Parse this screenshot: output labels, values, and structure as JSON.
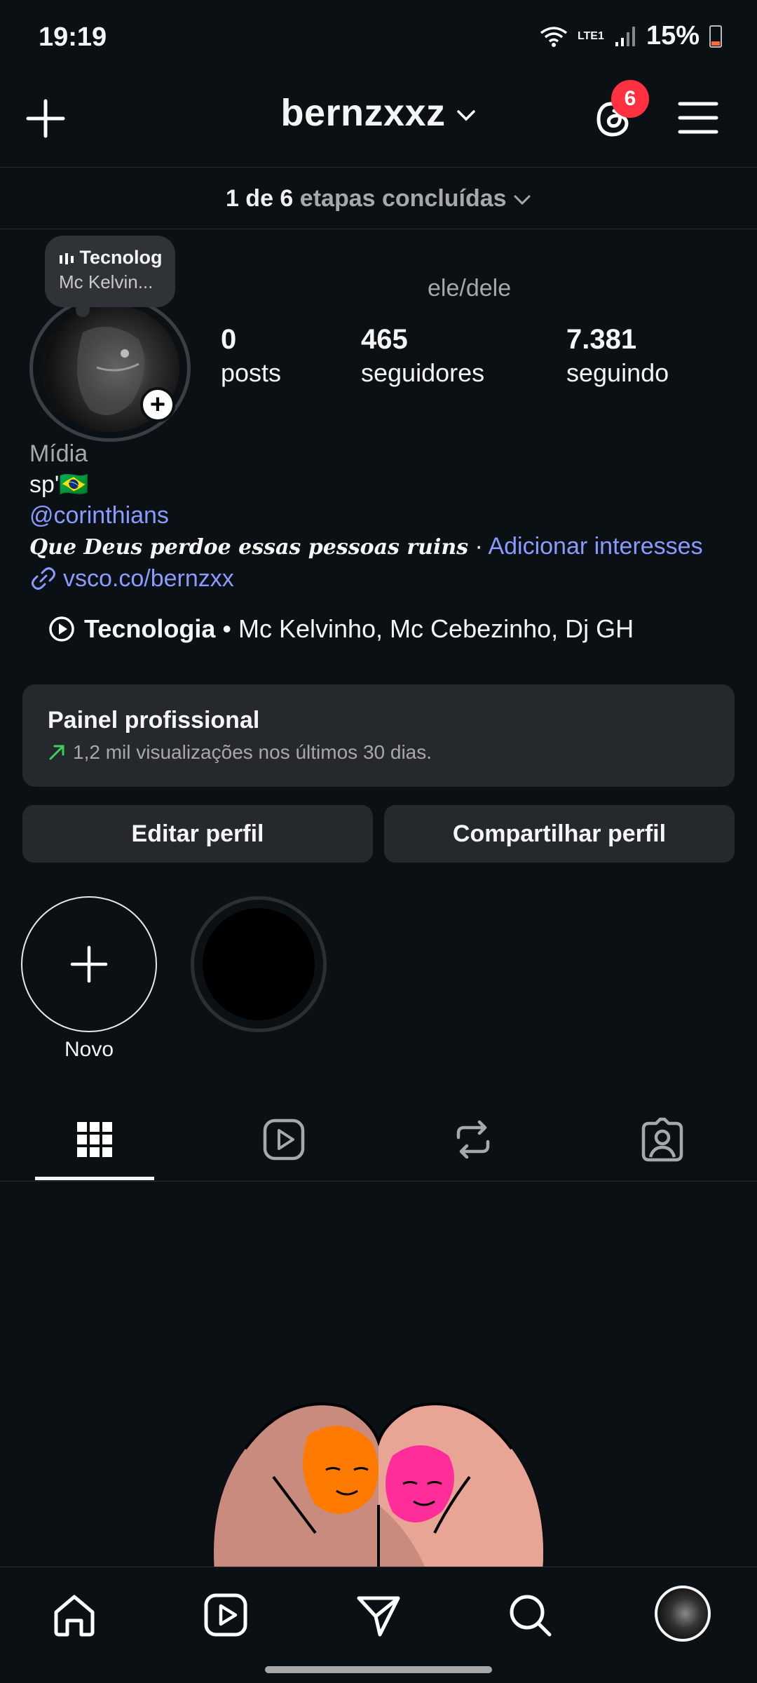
{
  "status": {
    "time": "19:19",
    "battery": "15%",
    "network": "LTE1"
  },
  "header": {
    "username": "bernzxxz",
    "threads_badge": "6"
  },
  "steps": {
    "progress": "1 de 6",
    "rest": "etapas concluídas"
  },
  "note": {
    "line1": "Tecnolog",
    "line2": "Mc Kelvin..."
  },
  "profile": {
    "pronouns": "ele/dele",
    "stats": [
      {
        "value": "0",
        "label": "posts"
      },
      {
        "value": "465",
        "label": "seguidores"
      },
      {
        "value": "7.381",
        "label": "seguindo"
      }
    ],
    "category": "Mídia",
    "bio_line1": "sp'🇧🇷",
    "mention": "@corinthians",
    "quote": "Que Deus perdoe essas pessoas ruins",
    "separator": " · ",
    "add_interests": "Adicionar interesses",
    "link": "vsco.co/bernzxx"
  },
  "music": {
    "title": "Tecnologia",
    "artists": " • Mc Kelvinho, Mc Cebezinho, Dj GH"
  },
  "panel": {
    "title": "Painel profissional",
    "subtitle": "1,2 mil visualizações nos últimos 30 dias."
  },
  "buttons": {
    "edit": "Editar perfil",
    "share": "Compartilhar perfil"
  },
  "highlights": {
    "new_label": "Novo"
  },
  "colors": {
    "accent_link": "#8a9bff",
    "badge": "#ff3040",
    "background": "#0b1014",
    "card": "#25292e"
  }
}
